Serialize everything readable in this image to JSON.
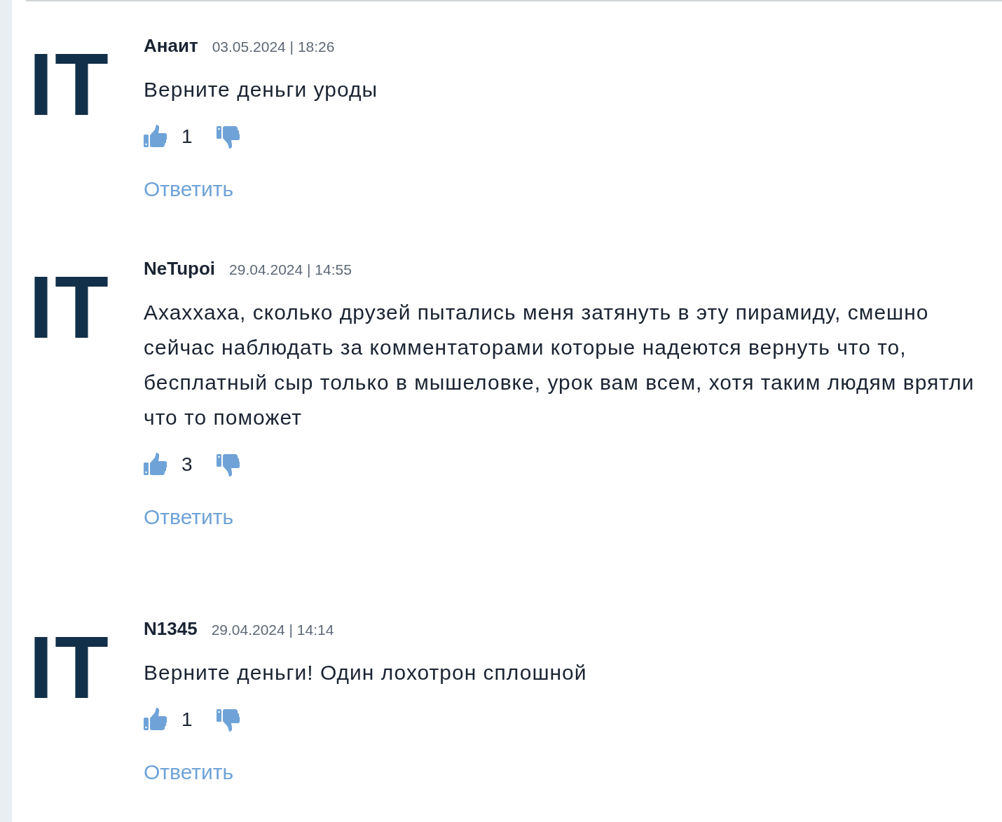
{
  "comments": [
    {
      "avatar": "IT",
      "author": "Анаит",
      "date": "03.05.2024 | 18:26",
      "text": "Верните деньги уроды",
      "likes": "1",
      "reply": "Ответить"
    },
    {
      "avatar": "IT",
      "author": "NeTupoi",
      "date": "29.04.2024 | 14:55",
      "text": "Ахаххаха, сколько друзей пытались меня затянуть в эту пирамиду, смешно сейчас наблюдать за комментаторами которые надеются вернуть что то, бесплатный сыр только в мышеловке, урок вам всем, хотя таким людям врятли что то поможет",
      "likes": "3",
      "reply": "Ответить"
    },
    {
      "avatar": "IT",
      "author": "N1345",
      "date": "29.04.2024 | 14:14",
      "text": "Верните деньги! Один лохотрон сплошной",
      "likes": "1",
      "reply": "Ответить"
    }
  ]
}
